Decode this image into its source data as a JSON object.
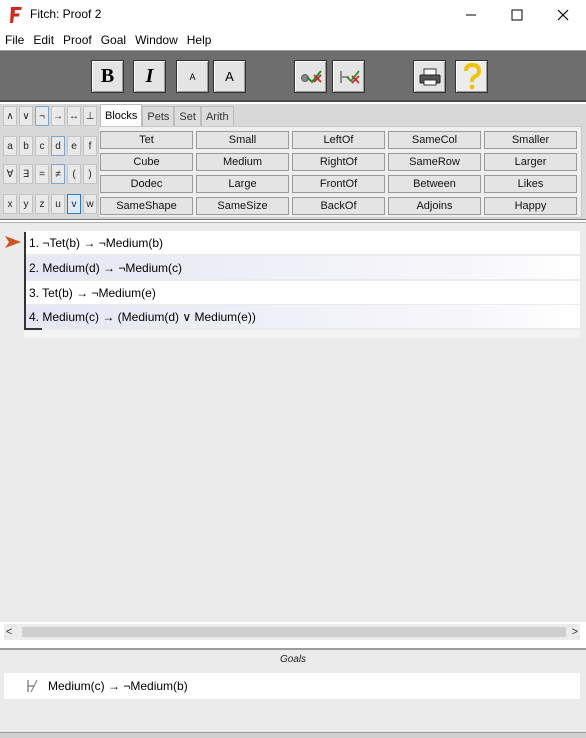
{
  "window": {
    "title": "Fitch: Proof 2"
  },
  "menu": [
    "File",
    "Edit",
    "Proof",
    "Goal",
    "Window",
    "Help"
  ],
  "toolbar": {
    "bold_label": "B",
    "italic_label": "I",
    "small_font_label": "A",
    "large_font_label": "A"
  },
  "symbols": {
    "row1": [
      "∧",
      "∨",
      "¬",
      "→",
      "↔",
      "⊥"
    ],
    "row2": [
      "a",
      "b",
      "c",
      "d",
      "e",
      "f"
    ],
    "row3": [
      "∀",
      "∃",
      "=",
      "≠",
      "(",
      ")"
    ],
    "row4": [
      "x",
      "y",
      "z",
      "u",
      "v",
      "w"
    ]
  },
  "tabs": [
    "Blocks",
    "Pets",
    "Set",
    "Arith"
  ],
  "active_tab": "Blocks",
  "predicates": [
    [
      "Tet",
      "Small",
      "LeftOf",
      "SameCol",
      "Smaller"
    ],
    [
      "Cube",
      "Medium",
      "RightOf",
      "SameRow",
      "Larger"
    ],
    [
      "Dodec",
      "Large",
      "FrontOf",
      "Between",
      "Likes"
    ],
    [
      "SameShape",
      "SameSize",
      "BackOf",
      "Adjoins",
      "Happy"
    ]
  ],
  "proof": {
    "lines": [
      "1. ¬Tet(b) → ¬Medium(b)",
      "2. Medium(d) → ¬Medium(c)",
      "3. Tet(b) → ¬Medium(e)",
      "4. Medium(c) → (Medium(d) ∨ Medium(e))"
    ]
  },
  "scrollbar": {
    "left_arrow": "<",
    "right_arrow": ">"
  },
  "goals": {
    "title": "Goals",
    "items": [
      "Medium(c) → ¬Medium(b)"
    ]
  },
  "colors": {
    "toolbar_bg": "#6e6e6e",
    "proof_arrow": "#d0541c",
    "app_icon": "#d7261e",
    "selected_symbol_border": "#2b7bbf"
  }
}
